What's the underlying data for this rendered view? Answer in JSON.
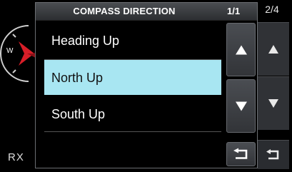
{
  "background": {
    "page_indicator": "2/4",
    "rx_label": "RX",
    "compass_west_label": "W"
  },
  "dialog": {
    "title": "COMPASS DIRECTION",
    "page_indicator": "1/1",
    "options": [
      {
        "label": "Heading Up",
        "selected": false
      },
      {
        "label": "North Up",
        "selected": true
      },
      {
        "label": "South Up",
        "selected": false
      }
    ],
    "buttons": {
      "up": "up-arrow-icon",
      "down": "down-arrow-icon",
      "back": "return-arrow-icon"
    }
  },
  "colors": {
    "selected_row": "#a8e6f2",
    "compass_needle": "#d81e28"
  }
}
